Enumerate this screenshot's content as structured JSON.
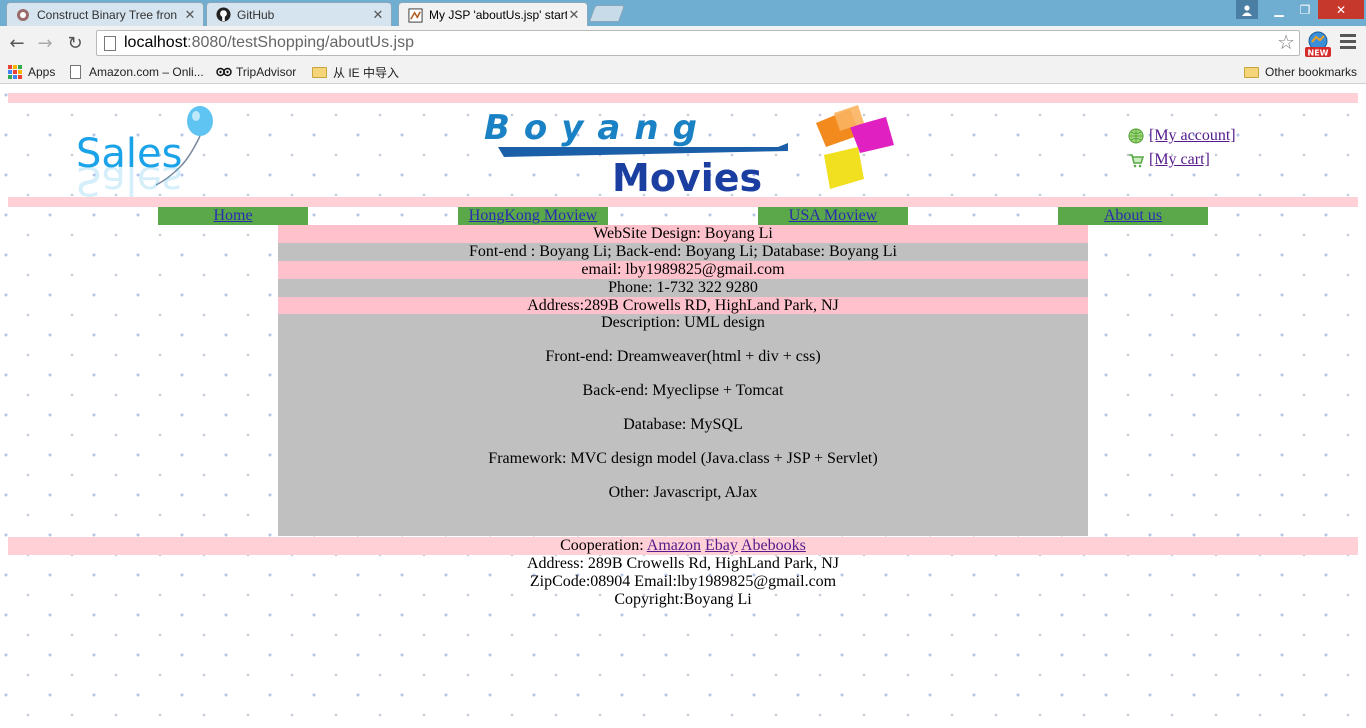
{
  "browser": {
    "tabs": [
      {
        "title": "Construct Binary Tree fron",
        "active": false
      },
      {
        "title": "GitHub",
        "active": false
      },
      {
        "title": "My JSP 'aboutUs.jsp' starti",
        "active": true
      }
    ],
    "url_host": "localhost",
    "url_rest": ":8080/testShopping/aboutUs.jsp",
    "extension_badge": "NEW",
    "bookmarks": [
      {
        "label": "Apps",
        "icon": "apps-grid-icon"
      },
      {
        "label": "Amazon.com – Onli...",
        "icon": "page-icon"
      },
      {
        "label": "TripAdvisor",
        "icon": "tripadvisor-icon"
      },
      {
        "label": "从 IE 中导入",
        "icon": "folder-icon"
      }
    ],
    "other_bookmarks": "Other bookmarks"
  },
  "header": {
    "logo_left_text": "Sales",
    "logo_center_top": "Boyang",
    "logo_center_bottom": "Movies",
    "my_account": "[My account]",
    "my_cart": "[My cart]"
  },
  "nav": {
    "items": [
      "Home",
      "HongKong Moview",
      "USA Moview",
      "About us"
    ]
  },
  "info": {
    "design": "WebSite Design: Boyang Li",
    "roles": "Font-end : Boyang Li; Back-end: Boyang Li; Database: Boyang Li",
    "email": "email: lby1989825@gmail.com",
    "phone": "Phone: 1-732 322 9280",
    "address": "Address:289B Crowells RD, HighLand Park, NJ"
  },
  "description": [
    "Description: UML design",
    "Front-end: Dreamweaver(html + div + css)",
    "Back-end: Myeclipse + Tomcat",
    "Database: MySQL",
    "Framework: MVC design model (Java.class + JSP + Servlet)",
    "Other: Javascript, AJax"
  ],
  "footer": {
    "cooperation_label": "Cooperation:",
    "partners": [
      "Amazon",
      "Ebay",
      "Abebooks"
    ],
    "address": "Address: 289B Crowells Rd, HighLand Park, NJ",
    "zip_email": "ZipCode:08904 Email:lby1989825@gmail.com",
    "copyright": "Copyright:Boyang Li"
  },
  "colors": {
    "titlebar": "#6faed1",
    "pink_band": "#ffd1d6",
    "pink_row": "#ffc2cc",
    "grey_row": "#c0c0c0",
    "nav_green": "#5aa84a",
    "visited_link": "#551a8b"
  }
}
